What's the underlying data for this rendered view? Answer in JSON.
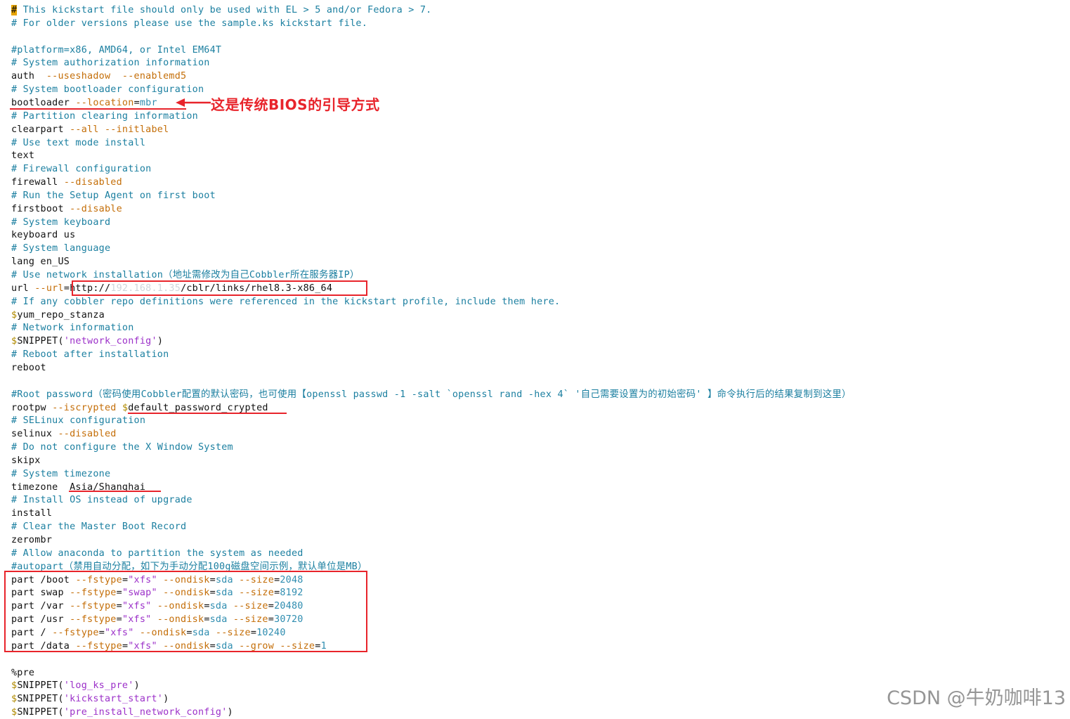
{
  "annotations": {
    "bios_note": "这是传统BIOS的引导方式"
  },
  "watermark": "CSDN @牛奶咖啡13",
  "colors": {
    "comment": "#1b7fa0",
    "keyword": "#111111",
    "option": "#c46e08",
    "string": "#9c31c9",
    "number": "#2f8db0",
    "variable_sigil": "#b08a00",
    "annotation_red": "#e8242b",
    "cursor": "#e7a400"
  },
  "lines": [
    [
      [
        "cursor",
        "#"
      ],
      [
        "c",
        " This kickstart file should only be used with EL > 5 and/or Fedora > 7."
      ]
    ],
    [
      [
        "c",
        "# For older versions please use the sample.ks kickstart file."
      ]
    ],
    [],
    [
      [
        "c",
        "#platform=x86, AMD64, or Intel EM64T"
      ]
    ],
    [
      [
        "c",
        "# System authorization information"
      ]
    ],
    [
      [
        "k",
        "auth  "
      ],
      [
        "o",
        "--useshadow  --enablemd5"
      ]
    ],
    [
      [
        "c",
        "# System bootloader configuration"
      ]
    ],
    [
      [
        "k",
        "bootloader "
      ],
      [
        "o",
        "--location"
      ],
      [
        "k",
        "="
      ],
      [
        "n",
        "mbr"
      ]
    ],
    [
      [
        "c",
        "# Partition clearing information"
      ]
    ],
    [
      [
        "k",
        "clearpart "
      ],
      [
        "o",
        "--all --initlabel"
      ]
    ],
    [
      [
        "c",
        "# Use text mode install"
      ]
    ],
    [
      [
        "k",
        "text"
      ]
    ],
    [
      [
        "c",
        "# Firewall configuration"
      ]
    ],
    [
      [
        "k",
        "firewall "
      ],
      [
        "o",
        "--disabled"
      ]
    ],
    [
      [
        "c",
        "# Run the Setup Agent on first boot"
      ]
    ],
    [
      [
        "k",
        "firstboot "
      ],
      [
        "o",
        "--disable"
      ]
    ],
    [
      [
        "c",
        "# System keyboard"
      ]
    ],
    [
      [
        "k",
        "keyboard us"
      ]
    ],
    [
      [
        "c",
        "# System language"
      ]
    ],
    [
      [
        "k",
        "lang en_US"
      ]
    ],
    [
      [
        "c",
        "# Use network installation（地址需修改为自己Cobbler所在服务器IP）"
      ]
    ],
    [
      [
        "k",
        "url "
      ],
      [
        "o",
        "--url"
      ],
      [
        "k",
        "="
      ],
      [
        "k",
        "http://"
      ],
      [
        "blur",
        "192.168.1.35"
      ],
      [
        "k",
        "/cblr/links/rhel8.3-x86_64"
      ]
    ],
    [
      [
        "c",
        "# If any cobbler repo definitions were referenced in the kickstart profile, include them here."
      ]
    ],
    [
      [
        "y",
        "$"
      ],
      [
        "k",
        "yum_repo_stanza"
      ]
    ],
    [
      [
        "c",
        "# Network information"
      ]
    ],
    [
      [
        "y",
        "$"
      ],
      [
        "k",
        "SNIPPET("
      ],
      [
        "s",
        "'network_config'"
      ],
      [
        "k",
        ")"
      ]
    ],
    [
      [
        "c",
        "# Reboot after installation"
      ]
    ],
    [
      [
        "k",
        "reboot"
      ]
    ],
    [],
    [
      [
        "c",
        "#Root password（密码使用Cobbler配置的默认密码，也可使用【openssl passwd -1 -salt `openssl rand -hex 4` '自己需要设置为的初始密码' 】命令执行后的结果复制到这里）"
      ]
    ],
    [
      [
        "k",
        "rootpw "
      ],
      [
        "o",
        "--iscrypted "
      ],
      [
        "y",
        "$"
      ],
      [
        "k",
        "default_password_crypted"
      ]
    ],
    [
      [
        "c",
        "# SELinux configuration"
      ]
    ],
    [
      [
        "k",
        "selinux "
      ],
      [
        "o",
        "--disabled"
      ]
    ],
    [
      [
        "c",
        "# Do not configure the X Window System"
      ]
    ],
    [
      [
        "k",
        "skipx"
      ]
    ],
    [
      [
        "c",
        "# System timezone"
      ]
    ],
    [
      [
        "k",
        "timezone  Asia/Shanghai"
      ]
    ],
    [
      [
        "c",
        "# Install OS instead of upgrade"
      ]
    ],
    [
      [
        "k",
        "install"
      ]
    ],
    [
      [
        "c",
        "# Clear the Master Boot Record"
      ]
    ],
    [
      [
        "k",
        "zerombr"
      ]
    ],
    [
      [
        "c",
        "# Allow anaconda to partition the system as needed"
      ]
    ],
    [
      [
        "c",
        "#autopart（禁用自动分配，如下为手动分配100g磁盘空间示例，默认单位是MB）"
      ]
    ],
    [
      [
        "k",
        "part /boot "
      ],
      [
        "o",
        "--fstype"
      ],
      [
        "k",
        "="
      ],
      [
        "s",
        "\"xfs\""
      ],
      [
        "o",
        " --ondisk"
      ],
      [
        "k",
        "="
      ],
      [
        "n",
        "sda"
      ],
      [
        "o",
        " --size"
      ],
      [
        "k",
        "="
      ],
      [
        "n",
        "2048"
      ]
    ],
    [
      [
        "k",
        "part swap "
      ],
      [
        "o",
        "--fstype"
      ],
      [
        "k",
        "="
      ],
      [
        "s",
        "\"swap\""
      ],
      [
        "o",
        " --ondisk"
      ],
      [
        "k",
        "="
      ],
      [
        "n",
        "sda"
      ],
      [
        "o",
        " --size"
      ],
      [
        "k",
        "="
      ],
      [
        "n",
        "8192"
      ]
    ],
    [
      [
        "k",
        "part /var "
      ],
      [
        "o",
        "--fstype"
      ],
      [
        "k",
        "="
      ],
      [
        "s",
        "\"xfs\""
      ],
      [
        "o",
        " --ondisk"
      ],
      [
        "k",
        "="
      ],
      [
        "n",
        "sda"
      ],
      [
        "o",
        " --size"
      ],
      [
        "k",
        "="
      ],
      [
        "n",
        "20480"
      ]
    ],
    [
      [
        "k",
        "part /usr "
      ],
      [
        "o",
        "--fstype"
      ],
      [
        "k",
        "="
      ],
      [
        "s",
        "\"xfs\""
      ],
      [
        "o",
        " --ondisk"
      ],
      [
        "k",
        "="
      ],
      [
        "n",
        "sda"
      ],
      [
        "o",
        " --size"
      ],
      [
        "k",
        "="
      ],
      [
        "n",
        "30720"
      ]
    ],
    [
      [
        "k",
        "part / "
      ],
      [
        "o",
        "--fstype"
      ],
      [
        "k",
        "="
      ],
      [
        "s",
        "\"xfs\""
      ],
      [
        "o",
        " --ondisk"
      ],
      [
        "k",
        "="
      ],
      [
        "n",
        "sda"
      ],
      [
        "o",
        " --size"
      ],
      [
        "k",
        "="
      ],
      [
        "n",
        "10240"
      ]
    ],
    [
      [
        "k",
        "part /data "
      ],
      [
        "o",
        "--fstype"
      ],
      [
        "k",
        "="
      ],
      [
        "s",
        "\"xfs\""
      ],
      [
        "o",
        " --ondisk"
      ],
      [
        "k",
        "="
      ],
      [
        "n",
        "sda"
      ],
      [
        "o",
        " --grow --size"
      ],
      [
        "k",
        "="
      ],
      [
        "n",
        "1"
      ]
    ],
    [],
    [
      [
        "k",
        "%pre"
      ]
    ],
    [
      [
        "y",
        "$"
      ],
      [
        "k",
        "SNIPPET("
      ],
      [
        "s",
        "'log_ks_pre'"
      ],
      [
        "k",
        ")"
      ]
    ],
    [
      [
        "y",
        "$"
      ],
      [
        "k",
        "SNIPPET("
      ],
      [
        "s",
        "'kickstart_start'"
      ],
      [
        "k",
        ")"
      ]
    ],
    [
      [
        "y",
        "$"
      ],
      [
        "k",
        "SNIPPET("
      ],
      [
        "s",
        "'pre_install_network_config'"
      ],
      [
        "k",
        ")"
      ]
    ]
  ]
}
